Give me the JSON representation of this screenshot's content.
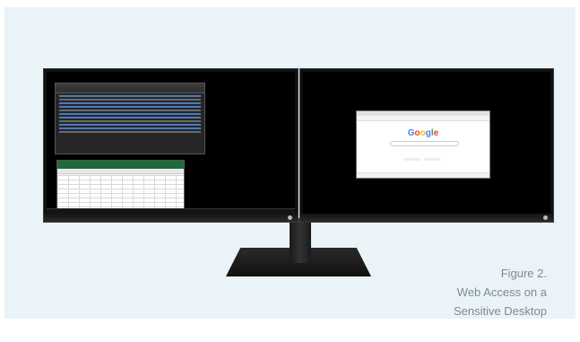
{
  "caption": {
    "line1": "Figure 2.",
    "line2": "Web Access on a",
    "line3": "Sensitive Desktop"
  },
  "browser": {
    "logo_text": "Google",
    "logo_colors": [
      "#4285f4",
      "#ea4335",
      "#fbbc05",
      "#4285f4",
      "#34a853",
      "#ea4335"
    ]
  },
  "colors": {
    "panel_background": "#eaf3f7",
    "caption_text": "#7d8b93",
    "monitor_body": "#101010"
  }
}
